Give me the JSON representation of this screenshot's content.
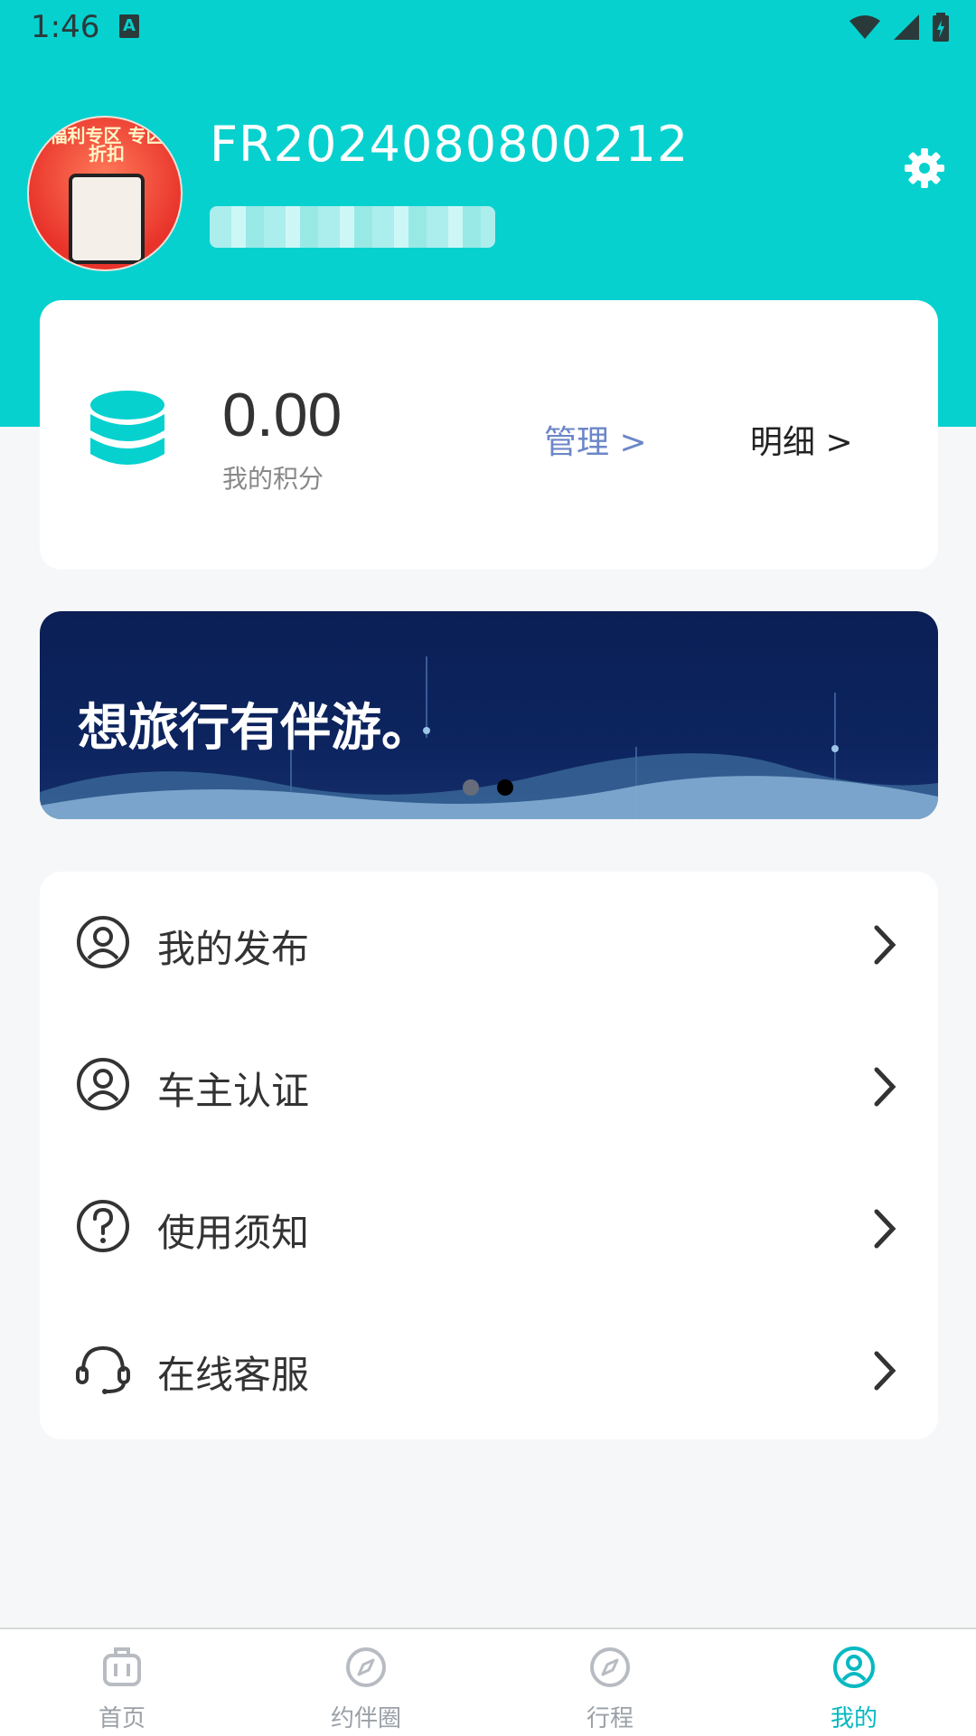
{
  "status_bar": {
    "time": "1:46",
    "notification_icon": "A"
  },
  "profile": {
    "username": "FR2024080800212",
    "avatar_text": "福利专区 专区折扣"
  },
  "points": {
    "value": "0.00",
    "label": "我的积分",
    "manage": "管理 >",
    "detail": "明细 >"
  },
  "banner": {
    "text": "想旅行有伴游。"
  },
  "menu": {
    "items": [
      {
        "label": "我的发布",
        "icon": "user-circle-icon"
      },
      {
        "label": "车主认证",
        "icon": "user-circle-icon"
      },
      {
        "label": "使用须知",
        "icon": "question-circle-icon"
      },
      {
        "label": "在线客服",
        "icon": "headset-icon"
      }
    ]
  },
  "bottom_nav": {
    "items": [
      {
        "label": "首页",
        "icon": "luggage-icon"
      },
      {
        "label": "约伴圈",
        "icon": "compass-icon"
      },
      {
        "label": "行程",
        "icon": "compass-icon"
      },
      {
        "label": "我的",
        "icon": "user-icon",
        "active": true
      }
    ]
  },
  "colors": {
    "accent": "#06d1cf",
    "link": "#6c86c8",
    "active_tab": "#06b9c1",
    "banner_bg": "#0b1f55"
  }
}
